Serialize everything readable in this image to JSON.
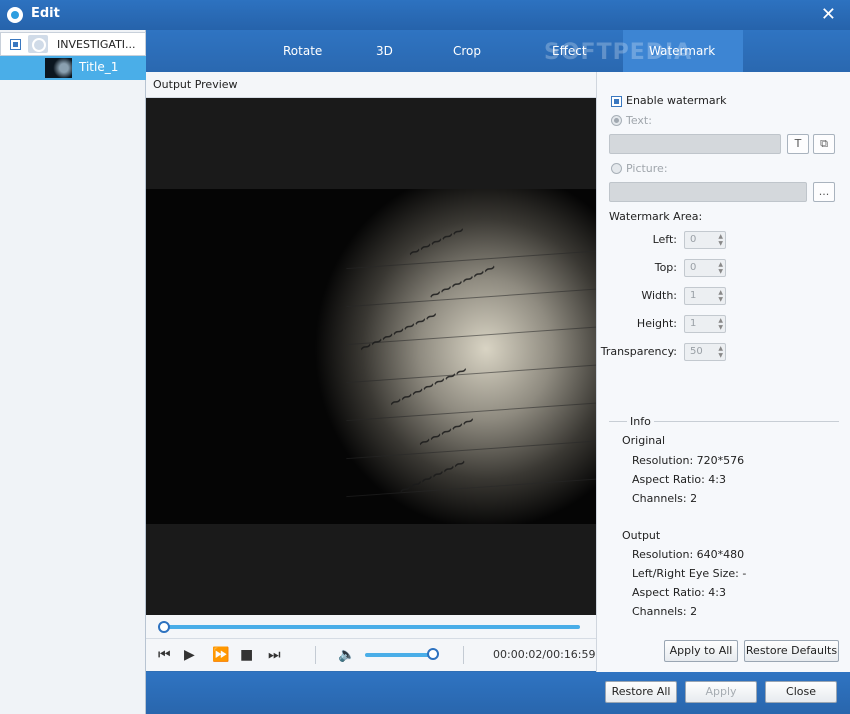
{
  "window": {
    "title": "Edit"
  },
  "tree": {
    "parent_label": "INVESTIGATI...",
    "child_label": "Title_1"
  },
  "tabs": [
    {
      "label": "Rotate"
    },
    {
      "label": "3D"
    },
    {
      "label": "Crop"
    },
    {
      "label": "Effect"
    },
    {
      "label": "Watermark"
    }
  ],
  "watermark_overlay_text": "SOFTPEDIA",
  "preview": {
    "header": "Output Preview",
    "timecode": "00:00:02/00:16:59",
    "seek_fraction": 0.0,
    "volume_fraction": 0.95
  },
  "watermark": {
    "enable_label": "Enable watermark",
    "enabled": true,
    "text_option": "Text:",
    "picture_option": "Picture:",
    "text_font_button": "T",
    "picture_browse_button": "...",
    "area_label": "Watermark Area:",
    "fields": [
      {
        "label": "Left:",
        "value": "0"
      },
      {
        "label": "Top:",
        "value": "0"
      },
      {
        "label": "Width:",
        "value": "1"
      },
      {
        "label": "Height:",
        "value": "1"
      },
      {
        "label": "Transparency:",
        "value": "50"
      }
    ]
  },
  "info": {
    "title": "Info",
    "original": {
      "heading": "Original",
      "lines": [
        "Resolution: 720*576",
        "Aspect Ratio: 4:3",
        "Channels: 2"
      ]
    },
    "output": {
      "heading": "Output",
      "lines": [
        "Resolution: 640*480",
        "Left/Right Eye Size: -",
        "Aspect Ratio: 4:3",
        "Channels: 2"
      ]
    }
  },
  "buttons": {
    "apply_to_all": "Apply to All",
    "restore_defaults": "Restore Defaults",
    "restore_all": "Restore All",
    "apply": "Apply",
    "close": "Close"
  },
  "colors": {
    "accent": "#2d72c0",
    "selection": "#4aaee8"
  }
}
